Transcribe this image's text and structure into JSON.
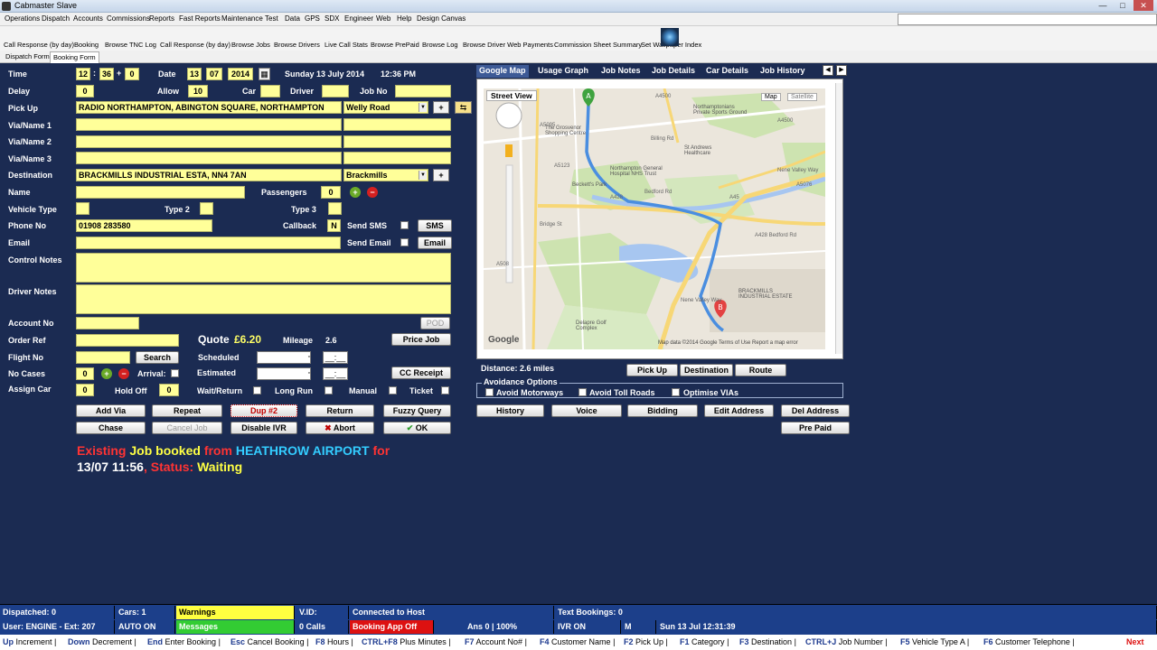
{
  "window": {
    "title": "Cabmaster Slave",
    "minimize": "—",
    "maximize": "□",
    "close": "✕"
  },
  "menu": [
    "Operations",
    "Dispatch",
    "Accounts",
    "Commissions",
    "Reports",
    "Fast Reports",
    "Maintenance",
    "Test",
    "Data",
    "GPS",
    "SDX",
    "Engineer",
    "Web",
    "Help",
    "Design Canvas"
  ],
  "quicklinks": [
    "Call Response (by day)",
    "Booking",
    "Browse TNC Log",
    "Call Response (by day)",
    "Browse Jobs",
    "Browse Drivers",
    "Live Call Stats",
    "Browse PrePaid",
    "Browse Log",
    "Browse Driver Web Payments",
    "Commission Sheet Summary",
    "Set Wallpaper Index"
  ],
  "doc_tabs": {
    "dispatch": "Dispatch Form",
    "booking": "Booking Form"
  },
  "form": {
    "time_label": "Time",
    "time_h": "12",
    "time_m": "36",
    "time_sep": ":",
    "time_plus": "+",
    "time_add": "0",
    "date_label": "Date",
    "date_d": "13",
    "date_m": "07",
    "date_y": "2014",
    "date_long": "Sunday 13 July 2014",
    "date_time": "12:36 PM",
    "delay_label": "Delay",
    "delay": "0",
    "allow_label": "Allow",
    "allow": "10",
    "car_label": "Car",
    "car": "",
    "driver_label": "Driver",
    "driver": "",
    "jobno_label": "Job No",
    "jobno": "",
    "pickup_label": "Pick Up",
    "pickup": "RADIO NORTHAMPTON, ABINGTON SQUARE, NORTHAMPTON",
    "pickup_area": "Welly Road",
    "via1_label": "Via/Name 1",
    "via2_label": "Via/Name 2",
    "via3_label": "Via/Name 3",
    "dest_label": "Destination",
    "dest": "BRACKMILLS INDUSTRIAL ESTA, NN4 7AN",
    "dest_area": "Brackmills",
    "name_label": "Name",
    "name": "",
    "passengers_label": "Passengers",
    "passengers": "0",
    "vehicle_label": "Vehicle Type",
    "type2_label": "Type 2",
    "type3_label": "Type 3",
    "phone_label": "Phone No",
    "phone": "01908 283580",
    "callback_label": "Callback",
    "callback": "N",
    "sendsms_label": "Send SMS",
    "sms_btn": "SMS",
    "email_label": "Email",
    "sendemail_label": "Send Email",
    "email_btn": "Email",
    "control_label": "Control Notes",
    "driver_notes_label": "Driver Notes",
    "account_label": "Account No",
    "pod_btn": "POD",
    "order_label": "Order Ref",
    "quote_label": "Quote",
    "quote_value": "£6.20",
    "mileage_label": "Mileage",
    "mileage": "2.6",
    "price_btn": "Price Job",
    "flight_label": "Flight No",
    "search_btn": "Search",
    "scheduled_label": "Scheduled",
    "time_blank": "__:__",
    "cases_label": "No Cases",
    "cases": "0",
    "arrival_label": "Arrival:",
    "estimated_label": "Estimated",
    "cc_btn": "CC Receipt",
    "assign_label": "Assign Car",
    "assign": "0",
    "holdoff_label": "Hold Off",
    "holdoff": "0",
    "waitreturn_label": "Wait/Return",
    "longrun_label": "Long Run",
    "manual_label": "Manual",
    "ticket_label": "Ticket"
  },
  "buttons": {
    "add_via": "Add Via",
    "repeat": "Repeat",
    "dup": "Dup #2",
    "return": "Return",
    "fuzzy": "Fuzzy Query",
    "chase": "Chase",
    "cancel_job": "Cancel Job",
    "disable_ivr": "Disable IVR",
    "abort": "Abort",
    "ok": "OK",
    "history": "History",
    "voice": "Voice",
    "bidding": "Bidding",
    "edit_address": "Edit Address",
    "del_address": "Del Address",
    "pre_paid": "Pre Paid",
    "pickup": "Pick Up",
    "destination": "Destination",
    "route": "Route"
  },
  "message": {
    "p1": "Existing",
    "p2": "Job booked",
    "p3": "from",
    "p4": "HEATHROW AIRPORT",
    "p5": "for",
    "p6": "13/07 11:56",
    "p7": ", Status:",
    "p8": "Waiting"
  },
  "map_tabs": [
    "Google Map",
    "Usage Graph",
    "Job Notes",
    "Job Details",
    "Car Details",
    "Job History"
  ],
  "map": {
    "street_view": "Street View",
    "map_btn": "Map",
    "satellite_btn": "Satellite",
    "google": "Google",
    "attribution": "Map data ©2014 Google    Terms of Use    Report a map error",
    "labels": [
      "A4500",
      "Northamptonians Private Sports Ground",
      "The Grosvenor Shopping Centre",
      "Billing Rd",
      "St Andrews Healthcare",
      "Northampton General Hospital NHS Trust",
      "Beckett's Park",
      "A428",
      "Bedford Rd",
      "A5123",
      "A45",
      "Nene Valley Way",
      "A428 Bedford Rd",
      "BRACKMILLS INDUSTRIAL ESTATE",
      "Delapre Golf Complex",
      "Nene Valley Way",
      "A508",
      "Bridge St",
      "A5095",
      "A4500",
      "A5076"
    ]
  },
  "distance": "Distance: 2.6 miles",
  "avoidance": {
    "title": "Avoidance Options",
    "motorways": "Avoid Motorways",
    "tolls": "Avoid Toll Roads",
    "vias": "Optimise VIAs"
  },
  "status1": {
    "dispatched": "Dispatched: 0",
    "cars": "Cars: 1",
    "warnings": "Warnings",
    "vid": "V.ID:",
    "connected": "Connected to Host",
    "text_bookings": "Text Bookings: 0"
  },
  "status2": {
    "user": "User: ENGINE - Ext: 207",
    "auto": "AUTO ON",
    "messages": "Messages",
    "calls": "0 Calls",
    "booking_app": "Booking App Off",
    "ans": "Ans 0 | 100%",
    "ivr": "IVR ON",
    "m": "M",
    "datetime": "Sun 13 Jul 12:31:39"
  },
  "hotkeys": [
    {
      "k": "Up",
      "t": "Increment"
    },
    {
      "k": "Down",
      "t": "Decrement"
    },
    {
      "k": "End",
      "t": "Enter Booking"
    },
    {
      "k": "Esc",
      "t": "Cancel Booking"
    },
    {
      "k": "F8",
      "t": "Hours"
    },
    {
      "k": "CTRL+F8",
      "t": "Plus Minutes"
    },
    {
      "k": "F7",
      "t": "Account No#"
    },
    {
      "k": "F4",
      "t": "Customer Name"
    },
    {
      "k": "F2",
      "t": "Pick Up"
    },
    {
      "k": "F1",
      "t": "Category"
    },
    {
      "k": "F3",
      "t": "Destination"
    },
    {
      "k": "CTRL+J",
      "t": "Job Number"
    },
    {
      "k": "F5",
      "t": "Vehicle Type A"
    },
    {
      "k": "F6",
      "t": "Customer Telephone"
    }
  ],
  "hotkeys_next": "Next",
  "colors": {
    "background": "#1b2b52",
    "field": "#ffff99",
    "status_bar": "#1c3f8a",
    "warnings": "#ffff40",
    "messages": "#33cc33",
    "booking_off": "#dd1111"
  }
}
